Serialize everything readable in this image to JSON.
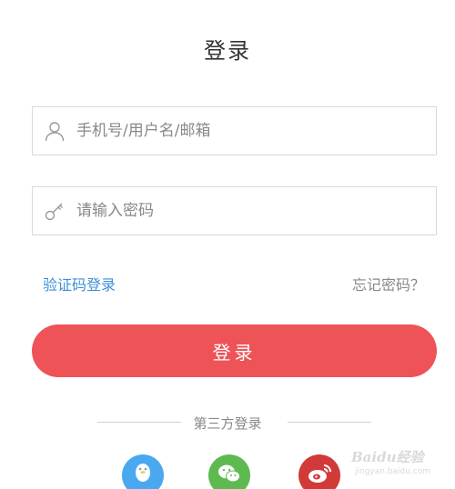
{
  "page": {
    "title": "登录"
  },
  "form": {
    "username_placeholder": "手机号/用户名/邮箱",
    "password_placeholder": "请输入密码",
    "sms_login_link": "验证码登录",
    "forgot_password_link": "忘记密码？",
    "login_button": "登录"
  },
  "third_party": {
    "label": "第三方登录",
    "providers": [
      {
        "name": "qq",
        "icon": "qq-penguin-icon",
        "color": "#4aa8f0"
      },
      {
        "name": "wechat",
        "icon": "wechat-icon",
        "color": "#5cba4e"
      },
      {
        "name": "weibo",
        "icon": "weibo-icon",
        "color": "#d23a3a"
      }
    ]
  },
  "watermark": {
    "main": "Baidu经验",
    "sub": "jingyan.baidu.com"
  },
  "colors": {
    "accent": "#ee5358",
    "link": "#3d8fd6",
    "muted": "#888888"
  }
}
